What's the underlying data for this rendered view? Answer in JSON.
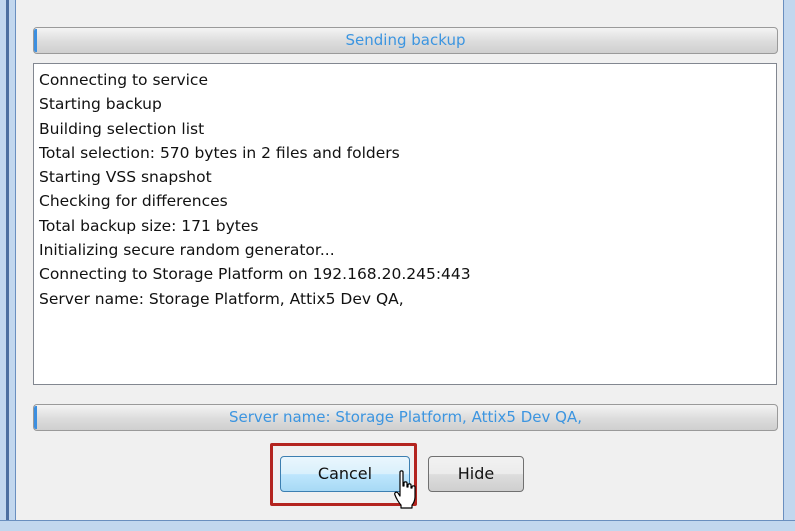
{
  "dialog": {
    "status_title": "Sending backup",
    "log_lines": [
      "Connecting to service",
      "Starting backup",
      "Building selection list",
      "Total selection: 570 bytes in 2 files and folders",
      "Starting VSS snapshot",
      "Checking for differences",
      "Total backup size: 171 bytes",
      "Initializing secure random generator...",
      "Connecting to Storage Platform on 192.168.20.245:443",
      "Server name: Storage Platform, Attix5 Dev QA,"
    ],
    "status_message": "Server name: Storage Platform, Attix5 Dev QA,",
    "buttons": {
      "cancel_label": "Cancel",
      "hide_label": "Hide"
    }
  },
  "colors": {
    "status_text": "#3c95e0",
    "highlight_border": "#b3241f",
    "cancel_hover_bg": "#bee6fd"
  },
  "icons": {
    "cursor": "hand-pointer-icon"
  }
}
